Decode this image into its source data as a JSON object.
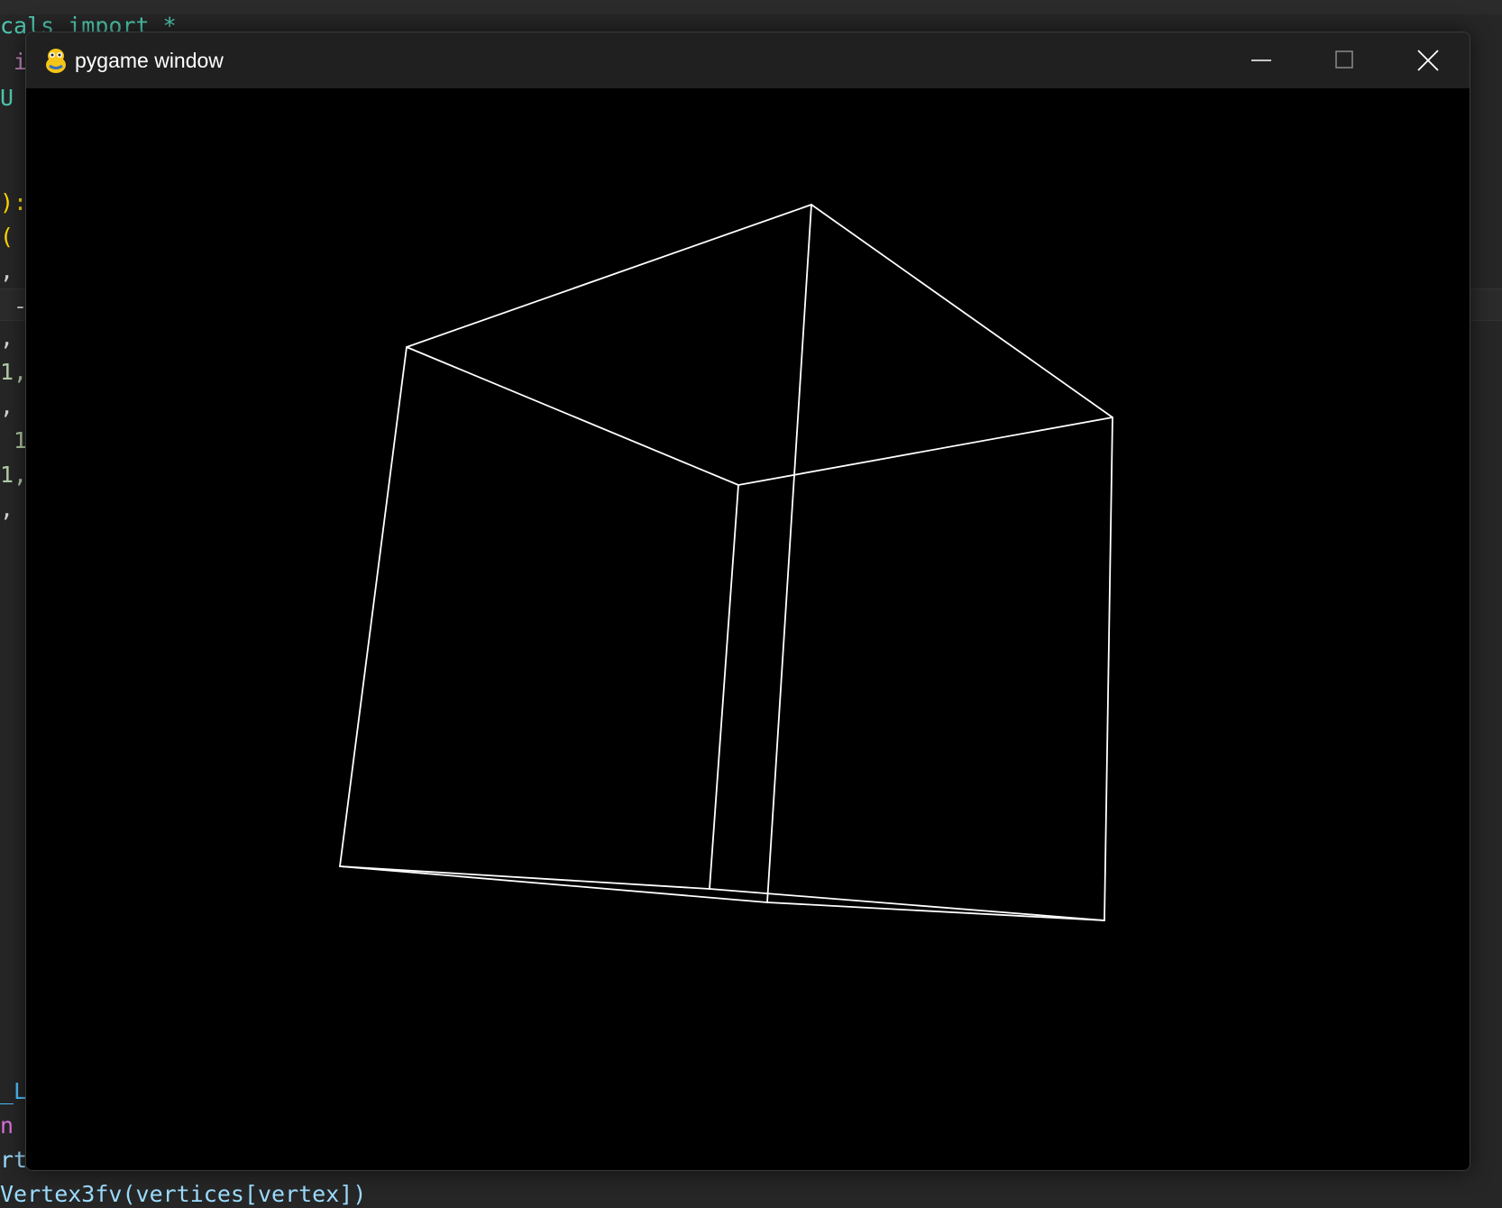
{
  "window": {
    "title": "pygame window",
    "icon": "pygame-snake-icon",
    "controls": [
      "minimize-icon",
      "maximize-icon",
      "close-icon"
    ]
  },
  "background_code": {
    "line1": "cals import *",
    "line2": " i",
    "line3": "U",
    "line4": "):",
    "line5": "(",
    "line6": ",",
    "line7": " -",
    "line8": ",",
    "line9": "1,",
    "line10": ",",
    "line11": " 1",
    "line12": "1,",
    "line13": ",",
    "line14": "_L",
    "line15": "n",
    "line16": "rt",
    "line17": "Vertex3fv(vertices[vertex])"
  },
  "scene": {
    "description_type": "wireframe-cube",
    "line_color": "#ffffff",
    "background_color": "#000000"
  },
  "colors": {
    "editor_bg": "#262626",
    "titlebar_bg": "#202020",
    "title_text": "#ffffff"
  }
}
